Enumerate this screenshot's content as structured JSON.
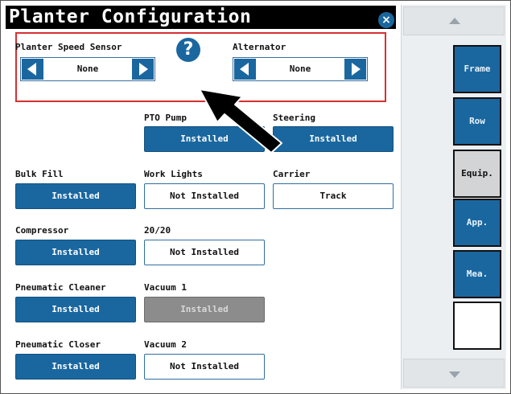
{
  "title": "Planter Configuration",
  "close_label": "×",
  "help_label": "?",
  "speed_sensor": {
    "label": "Planter Speed Sensor",
    "value": "None"
  },
  "alternator": {
    "label": "Alternator",
    "value": "None"
  },
  "options": {
    "pto_pump": {
      "label": "PTO Pump",
      "value": "Installed"
    },
    "steering": {
      "label": "Steering",
      "value": "Installed"
    },
    "bulk_fill": {
      "label": "Bulk Fill",
      "value": "Installed"
    },
    "work_lights": {
      "label": "Work Lights",
      "value": "Not Installed"
    },
    "carrier": {
      "label": "Carrier",
      "value": "Track"
    },
    "compressor": {
      "label": "Compressor",
      "value": "Installed"
    },
    "twenty_twenty": {
      "label": "20/20",
      "value": "Not Installed"
    },
    "pneumatic_cleaner": {
      "label": "Pneumatic Cleaner",
      "value": "Installed"
    },
    "vacuum_1": {
      "label": "Vacuum 1",
      "value": "Installed"
    },
    "pneumatic_closer": {
      "label": "Pneumatic Closer",
      "value": "Installed"
    },
    "vacuum_2": {
      "label": "Vacuum 2",
      "value": "Not Installed"
    }
  },
  "sidebar": {
    "tabs": [
      {
        "label": "Frame",
        "state": "normal"
      },
      {
        "label": "Row",
        "state": "normal"
      },
      {
        "label": "Equip.",
        "state": "selected"
      },
      {
        "label": "App.",
        "state": "normal"
      },
      {
        "label": "Mea.",
        "state": "normal"
      },
      {
        "label": "",
        "state": "empty"
      }
    ]
  },
  "colors": {
    "accent_blue": "#1a67a0",
    "highlight_red": "#d63031",
    "title_bar": "#000000",
    "disabled_gray": "#8c8c8c"
  },
  "icons": [
    "close-icon",
    "help-icon",
    "arrow-left-icon",
    "arrow-right-icon",
    "pointer-arrow-icon",
    "scroll-up-icon",
    "scroll-down-icon"
  ]
}
